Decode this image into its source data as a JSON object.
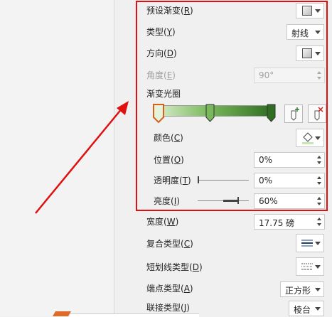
{
  "colors": {
    "accent": "#e01010",
    "gradient_start": "#d6ecc8",
    "gradient_end": "#2f6e22"
  },
  "fill": {
    "preset_gradient": {
      "label": "预设渐变",
      "hotkey": "R",
      "icon": "gradient-swatch-icon"
    },
    "type": {
      "label": "类型",
      "hotkey": "Y",
      "value": "射线"
    },
    "direction": {
      "label": "方向",
      "hotkey": "D",
      "icon": "gradient-swatch-icon"
    },
    "angle": {
      "label": "角度",
      "hotkey": "E",
      "value": "90°"
    },
    "gradient_stops": {
      "label": "渐变光圈",
      "add_icon": "add-stop-icon",
      "remove_icon": "remove-stop-icon"
    },
    "color": {
      "label": "颜色",
      "hotkey": "C",
      "icon": "paint-bucket-icon"
    },
    "position": {
      "label": "位置",
      "hotkey": "O",
      "value": "0%"
    },
    "transparency": {
      "label": "透明度",
      "hotkey": "T",
      "value": "0%",
      "level": 0
    },
    "brightness": {
      "label": "亮度",
      "hotkey": "I",
      "value": "60%",
      "level": 0.6
    }
  },
  "line": {
    "width": {
      "label": "宽度",
      "hotkey": "W",
      "value": "17.75 磅"
    },
    "compound_type": {
      "label": "复合类型",
      "hotkey": "C",
      "icon": "compound-lines-icon"
    },
    "dash_type": {
      "label": "短划线类型",
      "hotkey": "D",
      "icon": "dash-lines-icon"
    },
    "cap_type": {
      "label": "端点类型",
      "hotkey": "A",
      "value": "正方形"
    },
    "join_type": {
      "label": "联接类型",
      "hotkey": "J",
      "value": "棱台"
    }
  }
}
